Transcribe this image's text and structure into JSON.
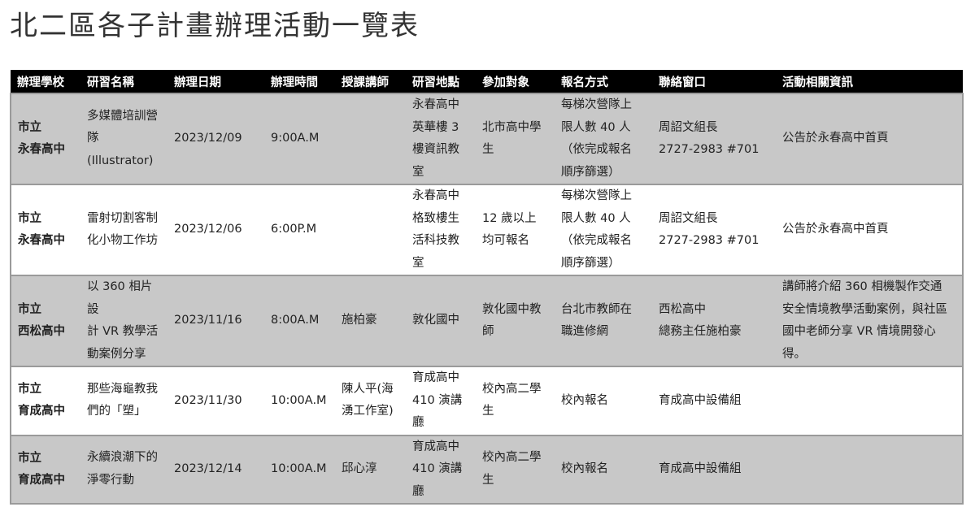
{
  "page_title": "北二區各子計畫辦理活動一覽表",
  "columns": [
    "辦理學校",
    "研習名稱",
    "辦理日期",
    "辦理時間",
    "授課講師",
    "研習地點",
    "參加對象",
    "報名方式",
    "聯絡窗口",
    "活動相關資訊"
  ],
  "rows": [
    {
      "school": [
        "市立",
        "永春高中"
      ],
      "name": [
        "多媒體培訓營",
        "隊(Illustrator)"
      ],
      "date": "2023/12/09",
      "time": "9:00A.M",
      "lecturer": [],
      "location": [
        "永春高中",
        "英華樓 3",
        "樓資訊教",
        "室"
      ],
      "audience": [
        "北市高中學",
        "生"
      ],
      "registration": [
        "每梯次營隊上",
        "限人數 40 人",
        "（依完成報名",
        "順序篩選）"
      ],
      "contact": [
        "周詔文組長",
        "2727-2983 #701"
      ],
      "info": [
        "公告於永春高中首頁"
      ]
    },
    {
      "school": [
        "市立",
        "永春高中"
      ],
      "name": [
        "雷射切割客制",
        "化小物工作坊"
      ],
      "date": "2023/12/06",
      "time": "6:00P.M",
      "lecturer": [],
      "location": [
        "永春高中",
        "格致樓生",
        "活科技教",
        "室"
      ],
      "audience": [
        "12 歲以上",
        "均可報名"
      ],
      "registration": [
        "每梯次營隊上",
        "限人數 40 人",
        "（依完成報名",
        "順序篩選）"
      ],
      "contact": [
        "周詔文組長",
        "2727-2983 #701"
      ],
      "info": [
        "公告於永春高中首頁"
      ]
    },
    {
      "school": [
        "市立",
        "西松高中"
      ],
      "name": [
        "以 360 相片設",
        "計 VR 教學活",
        "動案例分享"
      ],
      "date": "2023/11/16",
      "time": "8:00A.M",
      "lecturer": [
        "施柏豪"
      ],
      "location": [
        "敦化國中"
      ],
      "audience": [
        "敦化國中教",
        "師"
      ],
      "registration": [
        "台北市教師在",
        "職進修網"
      ],
      "contact": [
        "西松高中",
        "總務主任施柏豪"
      ],
      "info": [
        "講師將介紹 360 相機製作交通",
        "安全情境教學活動案例，與社區",
        "國中老師分享 VR 情境開發心",
        "得。"
      ]
    },
    {
      "school": [
        "市立",
        "育成高中"
      ],
      "name": [
        "那些海龜教我",
        "們的「塑」"
      ],
      "date": "2023/11/30",
      "time": "10:00A.M",
      "lecturer": [
        "陳人平(海",
        "湧工作室)"
      ],
      "location": [
        "育成高中",
        "410 演講",
        "廳"
      ],
      "audience": [
        "校內高二學",
        "生"
      ],
      "registration": [
        "校內報名"
      ],
      "contact": [
        "育成高中設備組"
      ],
      "info": []
    },
    {
      "school": [
        "市立",
        "育成高中"
      ],
      "name": [
        "永續浪潮下的",
        "淨零行動"
      ],
      "date": "2023/12/14",
      "time": "10:00A.M",
      "lecturer": [
        "邱心淳"
      ],
      "location": [
        "育成高中",
        "410 演講",
        "廳"
      ],
      "audience": [
        "校內高二學",
        "生"
      ],
      "registration": [
        "校內報名"
      ],
      "contact": [
        "育成高中設備組"
      ],
      "info": []
    }
  ]
}
